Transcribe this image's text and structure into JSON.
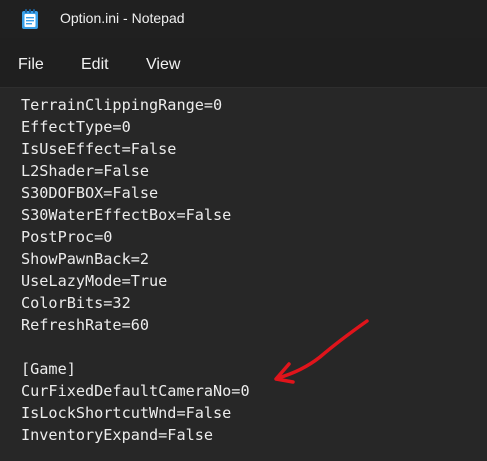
{
  "window": {
    "title": "Option.ini - Notepad"
  },
  "menu": {
    "file": "File",
    "edit": "Edit",
    "view": "View"
  },
  "editor": {
    "lines": [
      "TerrainClippingRange=0",
      "EffectType=0",
      "IsUseEffect=False",
      "L2Shader=False",
      "S30DOFBOX=False",
      "S30WaterEffectBox=False",
      "PostProc=0",
      "ShowPawnBack=2",
      "UseLazyMode=True",
      "ColorBits=32",
      "RefreshRate=60",
      "",
      "[Game]",
      "CurFixedDefaultCameraNo=0",
      "IsLockShortcutWnd=False",
      "InventoryExpand=False"
    ]
  },
  "annotation": {
    "icon": "red-arrow-icon",
    "color": "#e0141b"
  },
  "colors": {
    "background": "#1f1f1f",
    "editor_background": "#272727",
    "text": "#ececec",
    "notepad_icon": "#3aa0e8"
  }
}
